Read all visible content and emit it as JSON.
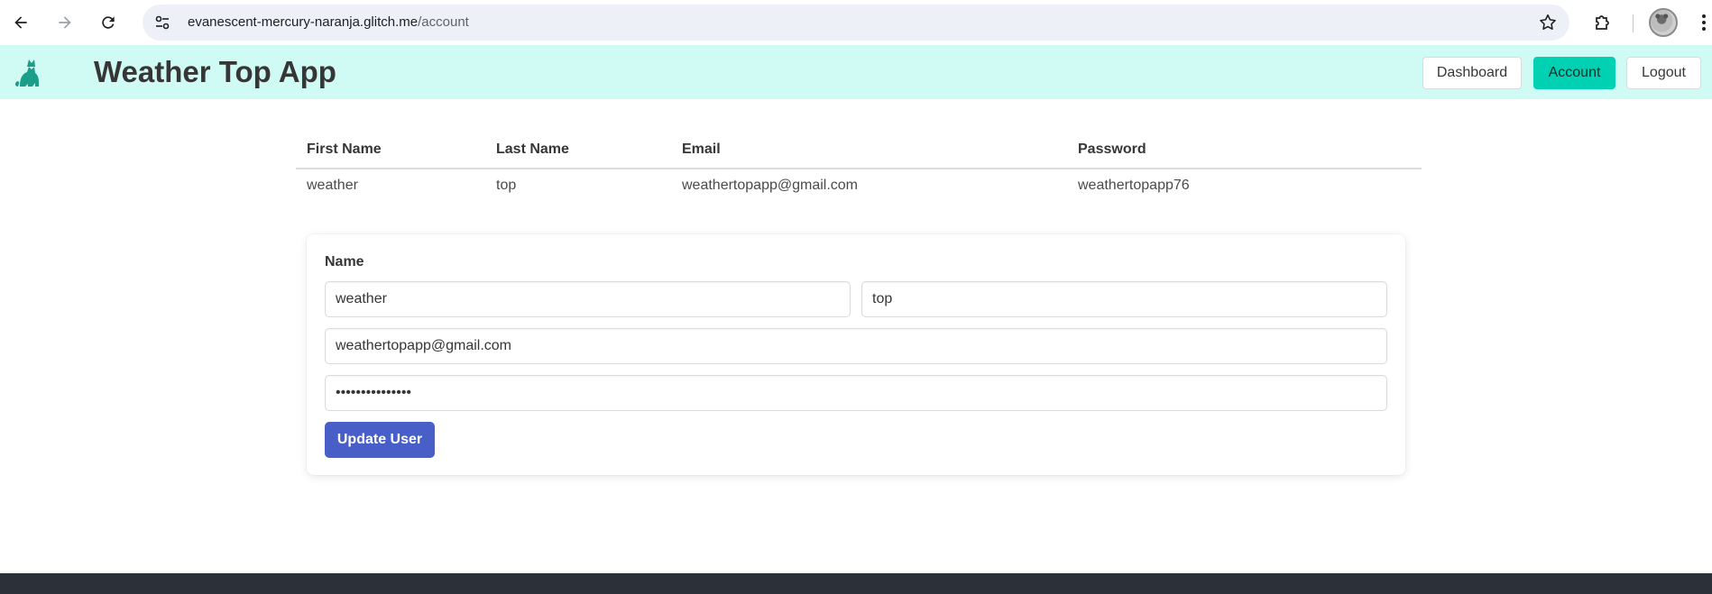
{
  "browser": {
    "url_host": "evanescent-mercury-naranja.glitch.me",
    "url_path": "/account"
  },
  "navbar": {
    "brand": "Weather Top App",
    "buttons": [
      {
        "label": "Dashboard",
        "active": false
      },
      {
        "label": "Account",
        "active": true
      },
      {
        "label": "Logout",
        "active": false
      }
    ]
  },
  "table": {
    "headers": [
      "First Name",
      "Last Name",
      "Email",
      "Password"
    ],
    "rows": [
      [
        "weather",
        "top",
        "weathertopapp@gmail.com",
        "weathertopapp76"
      ]
    ]
  },
  "form": {
    "name_label": "Name",
    "first_name_value": "weather",
    "last_name_value": "top",
    "email_value": "weathertopapp@gmail.com",
    "password_value": "weathertopapp76",
    "submit_label": "Update User"
  },
  "colors": {
    "navbar_bg": "#d0fbf5",
    "primary": "#00d1b2",
    "link": "#485fc7",
    "footer": "#2c3038"
  }
}
